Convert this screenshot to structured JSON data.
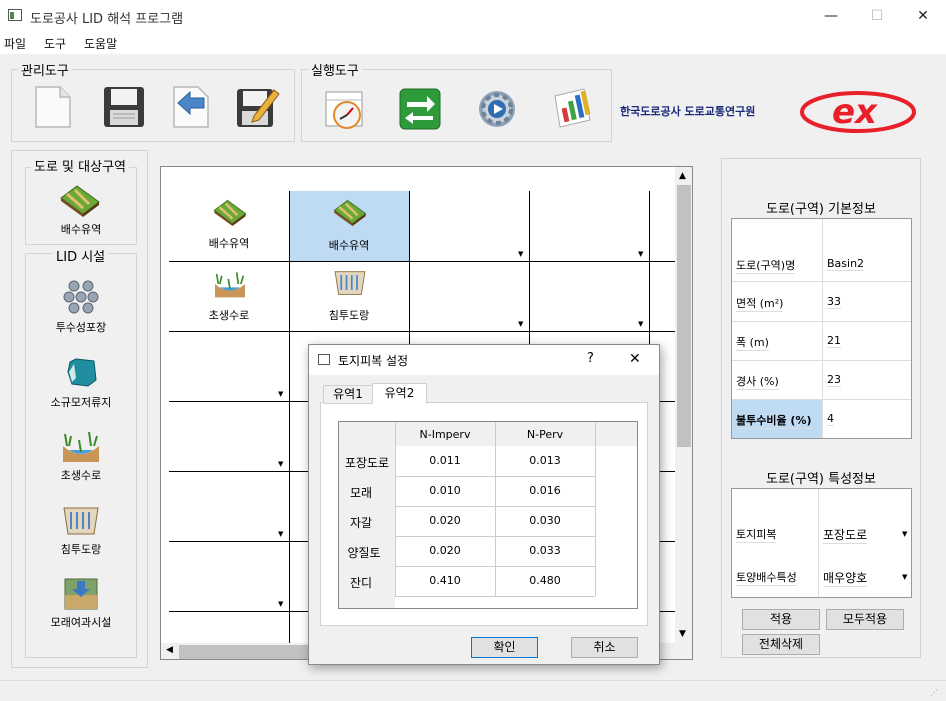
{
  "window": {
    "title": "도로공사 LID 해석 프로그램",
    "minimize": "—",
    "maximize": "☐",
    "close": "✕"
  },
  "menu": [
    "파일",
    "도구",
    "도움말"
  ],
  "toolbar": {
    "manage_label": "관리도구",
    "run_label": "실행도구",
    "org_text": "한국도로공사 도로교통연구원",
    "logo_text": "ex"
  },
  "left_panel": {
    "road_group": "도로 및 대상구역",
    "road_item": "배수유역",
    "lid_group": "LID 시설",
    "lid_items": [
      "투수성포장",
      "소규모저류지",
      "초생수로",
      "침투도랑",
      "모래여과시설"
    ]
  },
  "grid": {
    "cells": [
      {
        "label": "배수유역",
        "selected": false
      },
      {
        "label": "배수유역",
        "selected": true
      },
      {
        "label": "초생수로",
        "selected": false
      },
      {
        "label": "침투도랑",
        "selected": false
      }
    ]
  },
  "right_panel": {
    "basic_title": "도로(구역) 기본정보",
    "basic_rows": [
      {
        "label": "도로(구역)명",
        "value": "Basin2",
        "highlight": false
      },
      {
        "label": "면적 (m²)",
        "value": "33",
        "highlight": false
      },
      {
        "label": "폭 (m)",
        "value": "21",
        "highlight": false
      },
      {
        "label": "경사 (%)",
        "value": "23",
        "highlight": false
      },
      {
        "label": "불투수비율 (%)",
        "value": "4",
        "highlight": true
      }
    ],
    "feature_title": "도로(구역) 특성정보",
    "feature_rows": [
      {
        "label": "토지피복",
        "value": "포장도로"
      },
      {
        "label": "토양배수특성",
        "value": "매우양호"
      }
    ],
    "apply_button": "적용",
    "apply_all_button": "모두적용",
    "delete_all_button": "전체삭제"
  },
  "dialog": {
    "title": "토지피복 설정",
    "help": "?",
    "close": "✕",
    "tabs": [
      {
        "label": "유역1",
        "active": false
      },
      {
        "label": "유역2",
        "active": true
      }
    ],
    "columns": [
      "N-Imperv",
      "N-Perv"
    ],
    "rows": [
      {
        "name": "포장도로",
        "n_imperv": "0.011",
        "n_perv": "0.013"
      },
      {
        "name": "모래",
        "n_imperv": "0.010",
        "n_perv": "0.016"
      },
      {
        "name": "자갈",
        "n_imperv": "0.020",
        "n_perv": "0.030"
      },
      {
        "name": "양질토",
        "n_imperv": "0.020",
        "n_perv": "0.033"
      },
      {
        "name": "잔디",
        "n_imperv": "0.410",
        "n_perv": "0.480"
      }
    ],
    "ok_button": "확인",
    "cancel_button": "취소"
  }
}
